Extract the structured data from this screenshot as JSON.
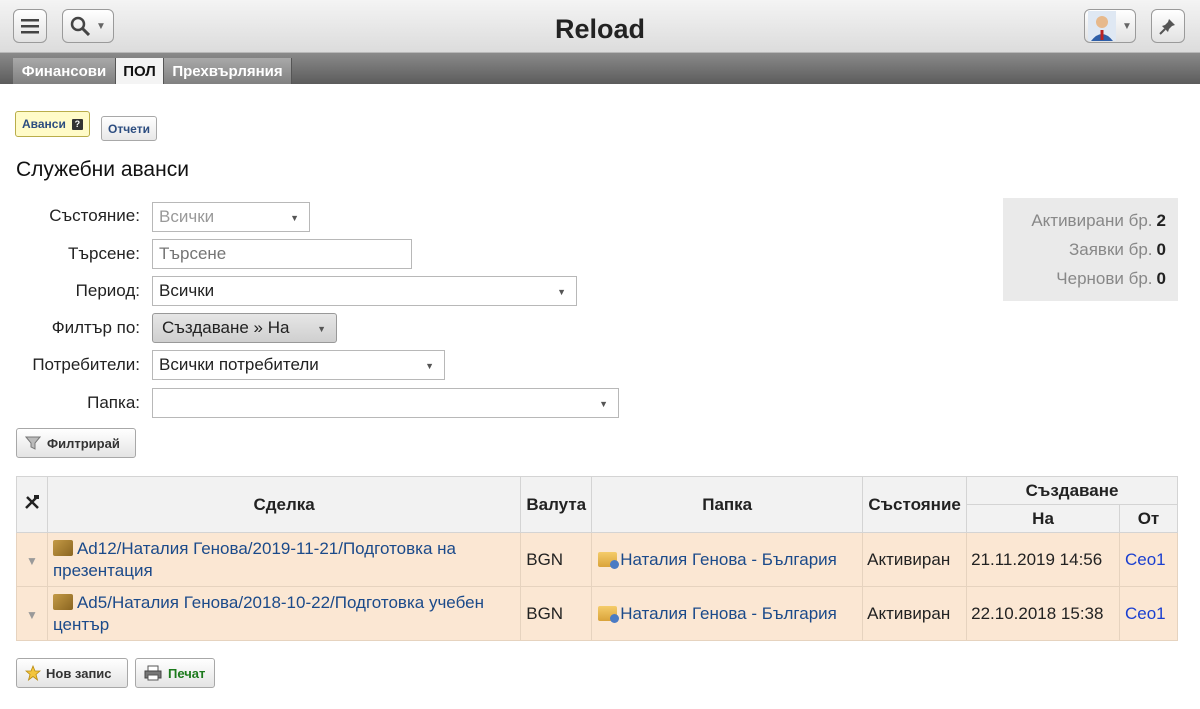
{
  "app": {
    "title": "Reload"
  },
  "tabs": [
    {
      "label": "Финансови",
      "active": false
    },
    {
      "label": "ПОЛ",
      "active": true
    },
    {
      "label": "Прехвърляния",
      "active": false
    }
  ],
  "subnav": {
    "advances_label": "Аванси",
    "help_badge": "?",
    "reports_label": "Отчети"
  },
  "page": {
    "title": "Служебни аванси"
  },
  "filters": {
    "state_label": "Състояние:",
    "state_value": "Всички",
    "search_label": "Търсене:",
    "search_placeholder": "Търсене",
    "period_label": "Период:",
    "period_value": "Всички",
    "filter_by_label": "Филтър по:",
    "filter_by_value": "Създаване » На",
    "users_label": "Потребители:",
    "users_value": "Всички потребители",
    "folder_label": "Папка:",
    "folder_value": "",
    "filter_button": "Филтрирай"
  },
  "stats": [
    {
      "label": "Активирани бр.",
      "value": "2"
    },
    {
      "label": "Заявки бр.",
      "value": "0"
    },
    {
      "label": "Чернови бр.",
      "value": "0"
    }
  ],
  "table": {
    "headers": {
      "deal": "Сделка",
      "currency": "Валута",
      "folder": "Папка",
      "state": "Състояние",
      "created": "Създаване",
      "on": "На",
      "by": "От"
    },
    "rows": [
      {
        "deal": "Ad12/Наталия Генова/2019-11-21/Подготовка на презентация",
        "currency": "BGN",
        "folder": "Наталия Генова - България",
        "state": "Активиран",
        "on": "21.11.2019 14:56",
        "by": "Ceo1"
      },
      {
        "deal": "Ad5/Наталия Генова/2018-10-22/Подготовка учебен център",
        "currency": "BGN",
        "folder": "Наталия Генова - България",
        "state": "Активиран",
        "on": "22.10.2018 15:38",
        "by": "Ceo1"
      }
    ]
  },
  "actions": {
    "new_label": "Нов запис",
    "print_label": "Печат"
  }
}
